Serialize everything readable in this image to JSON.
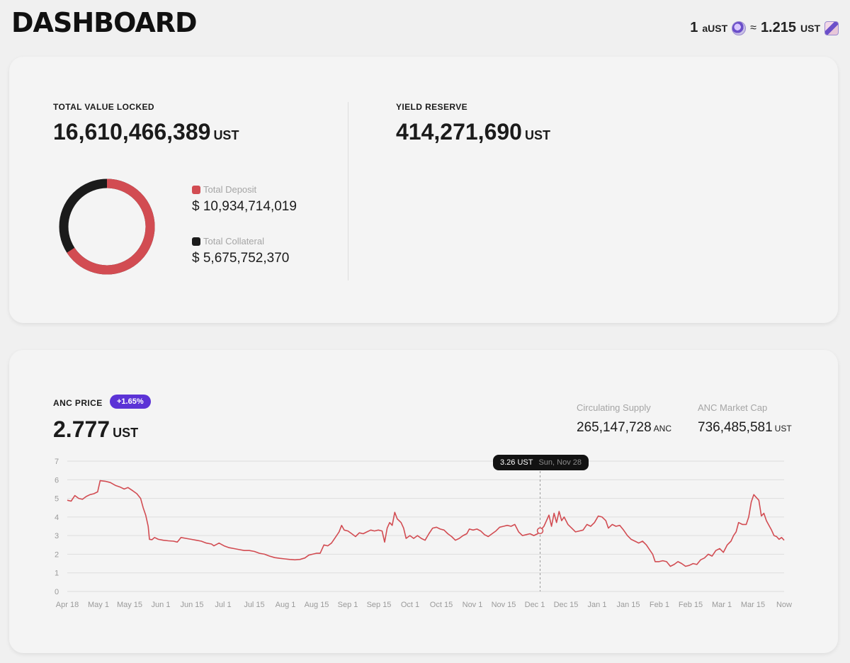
{
  "header": {
    "title": "DASHBOARD",
    "rate": {
      "left_amount": "1",
      "left_unit": "aUST",
      "approx": "≈",
      "right_amount": "1.215",
      "right_unit": "UST",
      "left_icon": "aust-coin-icon",
      "right_icon": "ust-coin-icon"
    }
  },
  "tvl": {
    "label": "TOTAL VALUE LOCKED",
    "value": "16,610,466,389",
    "unit": "UST",
    "donut_fraction_deposit": 0.658,
    "deposit": {
      "label": "Total Deposit",
      "value": "$ 10,934,714,019",
      "color": "#d24c52"
    },
    "collateral": {
      "label": "Total Collateral",
      "value": "$ 5,675,752,370",
      "color": "#1b1b1b"
    }
  },
  "yield_reserve": {
    "label": "YIELD RESERVE",
    "value": "414,271,690",
    "unit": "UST"
  },
  "anc": {
    "label": "ANC PRICE",
    "change_badge": "+1.65%",
    "badge_color": "#5c33d6",
    "price": "2.777",
    "price_unit": "UST",
    "circulating": {
      "label": "Circulating Supply",
      "value": "265,147,728",
      "unit": "ANC"
    },
    "market_cap": {
      "label": "ANC Market Cap",
      "value": "736,485,581",
      "unit": "UST"
    },
    "tooltip": {
      "price": "3.26 UST",
      "date": "Sun, Nov 28"
    }
  },
  "chart_data": {
    "type": "line",
    "title": "",
    "xlabel": "",
    "ylabel": "",
    "ylim": [
      0,
      7
    ],
    "yticks": [
      "0",
      "1",
      "2",
      "3",
      "4",
      "5",
      "6",
      "7"
    ],
    "xticks": [
      "Apr 18",
      "May 1",
      "May 15",
      "Jun 1",
      "Jun 15",
      "Jul 1",
      "Jul 15",
      "Aug 1",
      "Aug 15",
      "Sep 1",
      "Sep 15",
      "Oct 1",
      "Oct 15",
      "Nov 1",
      "Nov 15",
      "Dec 1",
      "Dec 15",
      "Jan 1",
      "Jan 15",
      "Feb 1",
      "Feb 15",
      "Mar 1",
      "Mar 15",
      "Now"
    ],
    "grid": true,
    "line_color": "#d24c52",
    "highlight": {
      "x": "Nov 28",
      "y": 3.26
    },
    "series": [
      {
        "values": [
          [
            0,
            4.9
          ],
          [
            3,
            4.85
          ],
          [
            6,
            5.15
          ],
          [
            9,
            5.0
          ],
          [
            12,
            4.95
          ],
          [
            15,
            5.1
          ],
          [
            18,
            5.2
          ],
          [
            21,
            5.25
          ],
          [
            24,
            5.35
          ],
          [
            26,
            5.95
          ],
          [
            30,
            5.92
          ],
          [
            34,
            5.85
          ],
          [
            38,
            5.7
          ],
          [
            42,
            5.6
          ],
          [
            45,
            5.5
          ],
          [
            48,
            5.58
          ],
          [
            52,
            5.4
          ],
          [
            55,
            5.25
          ],
          [
            58,
            5.0
          ],
          [
            60,
            4.5
          ],
          [
            62,
            4.1
          ],
          [
            64,
            3.5
          ],
          [
            65,
            2.8
          ],
          [
            67,
            2.78
          ],
          [
            69,
            2.9
          ],
          [
            72,
            2.8
          ],
          [
            76,
            2.75
          ],
          [
            80,
            2.72
          ],
          [
            84,
            2.7
          ],
          [
            87,
            2.65
          ],
          [
            90,
            2.9
          ],
          [
            94,
            2.85
          ],
          [
            98,
            2.8
          ],
          [
            102,
            2.75
          ],
          [
            106,
            2.7
          ],
          [
            110,
            2.6
          ],
          [
            114,
            2.55
          ],
          [
            116,
            2.45
          ],
          [
            120,
            2.6
          ],
          [
            124,
            2.45
          ],
          [
            128,
            2.35
          ],
          [
            132,
            2.3
          ],
          [
            136,
            2.25
          ],
          [
            140,
            2.2
          ],
          [
            144,
            2.2
          ],
          [
            148,
            2.15
          ],
          [
            152,
            2.05
          ],
          [
            156,
            2.0
          ],
          [
            160,
            1.9
          ],
          [
            164,
            1.82
          ],
          [
            168,
            1.78
          ],
          [
            172,
            1.75
          ],
          [
            176,
            1.72
          ],
          [
            180,
            1.7
          ],
          [
            184,
            1.72
          ],
          [
            188,
            1.8
          ],
          [
            191,
            1.95
          ],
          [
            194,
            2.0
          ],
          [
            197,
            2.05
          ],
          [
            200,
            2.05
          ],
          [
            203,
            2.5
          ],
          [
            206,
            2.45
          ],
          [
            209,
            2.6
          ],
          [
            212,
            2.9
          ],
          [
            215,
            3.2
          ],
          [
            217,
            3.55
          ],
          [
            219,
            3.3
          ],
          [
            222,
            3.25
          ],
          [
            225,
            3.1
          ],
          [
            228,
            2.95
          ],
          [
            231,
            3.15
          ],
          [
            234,
            3.1
          ],
          [
            237,
            3.2
          ],
          [
            240,
            3.3
          ],
          [
            243,
            3.25
          ],
          [
            246,
            3.3
          ],
          [
            249,
            3.25
          ],
          [
            251,
            2.65
          ],
          [
            253,
            3.4
          ],
          [
            255,
            3.7
          ],
          [
            257,
            3.55
          ],
          [
            259,
            4.25
          ],
          [
            261,
            3.9
          ],
          [
            264,
            3.7
          ],
          [
            266,
            3.4
          ],
          [
            268,
            2.85
          ],
          [
            271,
            3.0
          ],
          [
            274,
            2.85
          ],
          [
            277,
            3.0
          ],
          [
            280,
            2.85
          ],
          [
            283,
            2.75
          ],
          [
            286,
            3.1
          ],
          [
            289,
            3.4
          ],
          [
            292,
            3.45
          ],
          [
            295,
            3.35
          ],
          [
            298,
            3.3
          ],
          [
            301,
            3.1
          ],
          [
            304,
            2.95
          ],
          [
            307,
            2.75
          ],
          [
            310,
            2.85
          ],
          [
            313,
            3.0
          ],
          [
            316,
            3.1
          ],
          [
            318,
            3.35
          ],
          [
            321,
            3.3
          ],
          [
            324,
            3.35
          ],
          [
            327,
            3.25
          ],
          [
            330,
            3.05
          ],
          [
            333,
            2.95
          ],
          [
            336,
            3.1
          ],
          [
            339,
            3.25
          ],
          [
            342,
            3.45
          ],
          [
            345,
            3.5
          ],
          [
            348,
            3.55
          ],
          [
            351,
            3.5
          ],
          [
            354,
            3.6
          ],
          [
            357,
            3.2
          ],
          [
            360,
            3.0
          ],
          [
            363,
            3.05
          ],
          [
            366,
            3.1
          ],
          [
            369,
            3.0
          ],
          [
            372,
            3.1
          ],
          [
            374,
            3.26
          ],
          [
            377,
            3.5
          ],
          [
            379,
            3.8
          ],
          [
            381,
            4.1
          ],
          [
            383,
            3.5
          ],
          [
            385,
            4.2
          ],
          [
            387,
            3.7
          ],
          [
            389,
            4.3
          ],
          [
            391,
            3.8
          ],
          [
            393,
            4.0
          ],
          [
            396,
            3.6
          ],
          [
            399,
            3.4
          ],
          [
            402,
            3.2
          ],
          [
            405,
            3.25
          ],
          [
            408,
            3.3
          ],
          [
            411,
            3.6
          ],
          [
            414,
            3.5
          ],
          [
            417,
            3.7
          ],
          [
            420,
            4.05
          ],
          [
            423,
            4.0
          ],
          [
            426,
            3.8
          ],
          [
            428,
            3.4
          ],
          [
            431,
            3.6
          ],
          [
            434,
            3.5
          ],
          [
            437,
            3.55
          ],
          [
            440,
            3.3
          ],
          [
            443,
            3.0
          ],
          [
            446,
            2.8
          ],
          [
            449,
            2.7
          ],
          [
            452,
            2.6
          ],
          [
            455,
            2.7
          ],
          [
            458,
            2.5
          ],
          [
            461,
            2.2
          ],
          [
            463,
            2.0
          ],
          [
            465,
            1.6
          ],
          [
            468,
            1.6
          ],
          [
            471,
            1.65
          ],
          [
            474,
            1.6
          ],
          [
            477,
            1.35
          ],
          [
            480,
            1.45
          ],
          [
            483,
            1.6
          ],
          [
            486,
            1.5
          ],
          [
            489,
            1.35
          ],
          [
            492,
            1.4
          ],
          [
            495,
            1.5
          ],
          [
            498,
            1.45
          ],
          [
            501,
            1.7
          ],
          [
            504,
            1.8
          ],
          [
            507,
            2.0
          ],
          [
            510,
            1.9
          ],
          [
            513,
            2.2
          ],
          [
            516,
            2.3
          ],
          [
            519,
            2.1
          ],
          [
            522,
            2.5
          ],
          [
            525,
            2.7
          ],
          [
            527,
            3.0
          ],
          [
            529,
            3.2
          ],
          [
            531,
            3.7
          ],
          [
            534,
            3.6
          ],
          [
            537,
            3.6
          ],
          [
            539,
            4.0
          ],
          [
            541,
            4.8
          ],
          [
            543,
            5.2
          ],
          [
            545,
            5.05
          ],
          [
            547,
            4.9
          ],
          [
            549,
            4.05
          ],
          [
            551,
            4.2
          ],
          [
            553,
            3.8
          ],
          [
            555,
            3.55
          ],
          [
            557,
            3.3
          ],
          [
            559,
            3.0
          ],
          [
            561,
            2.95
          ],
          [
            563,
            2.8
          ],
          [
            565,
            2.9
          ],
          [
            567,
            2.75
          ]
        ]
      }
    ]
  }
}
